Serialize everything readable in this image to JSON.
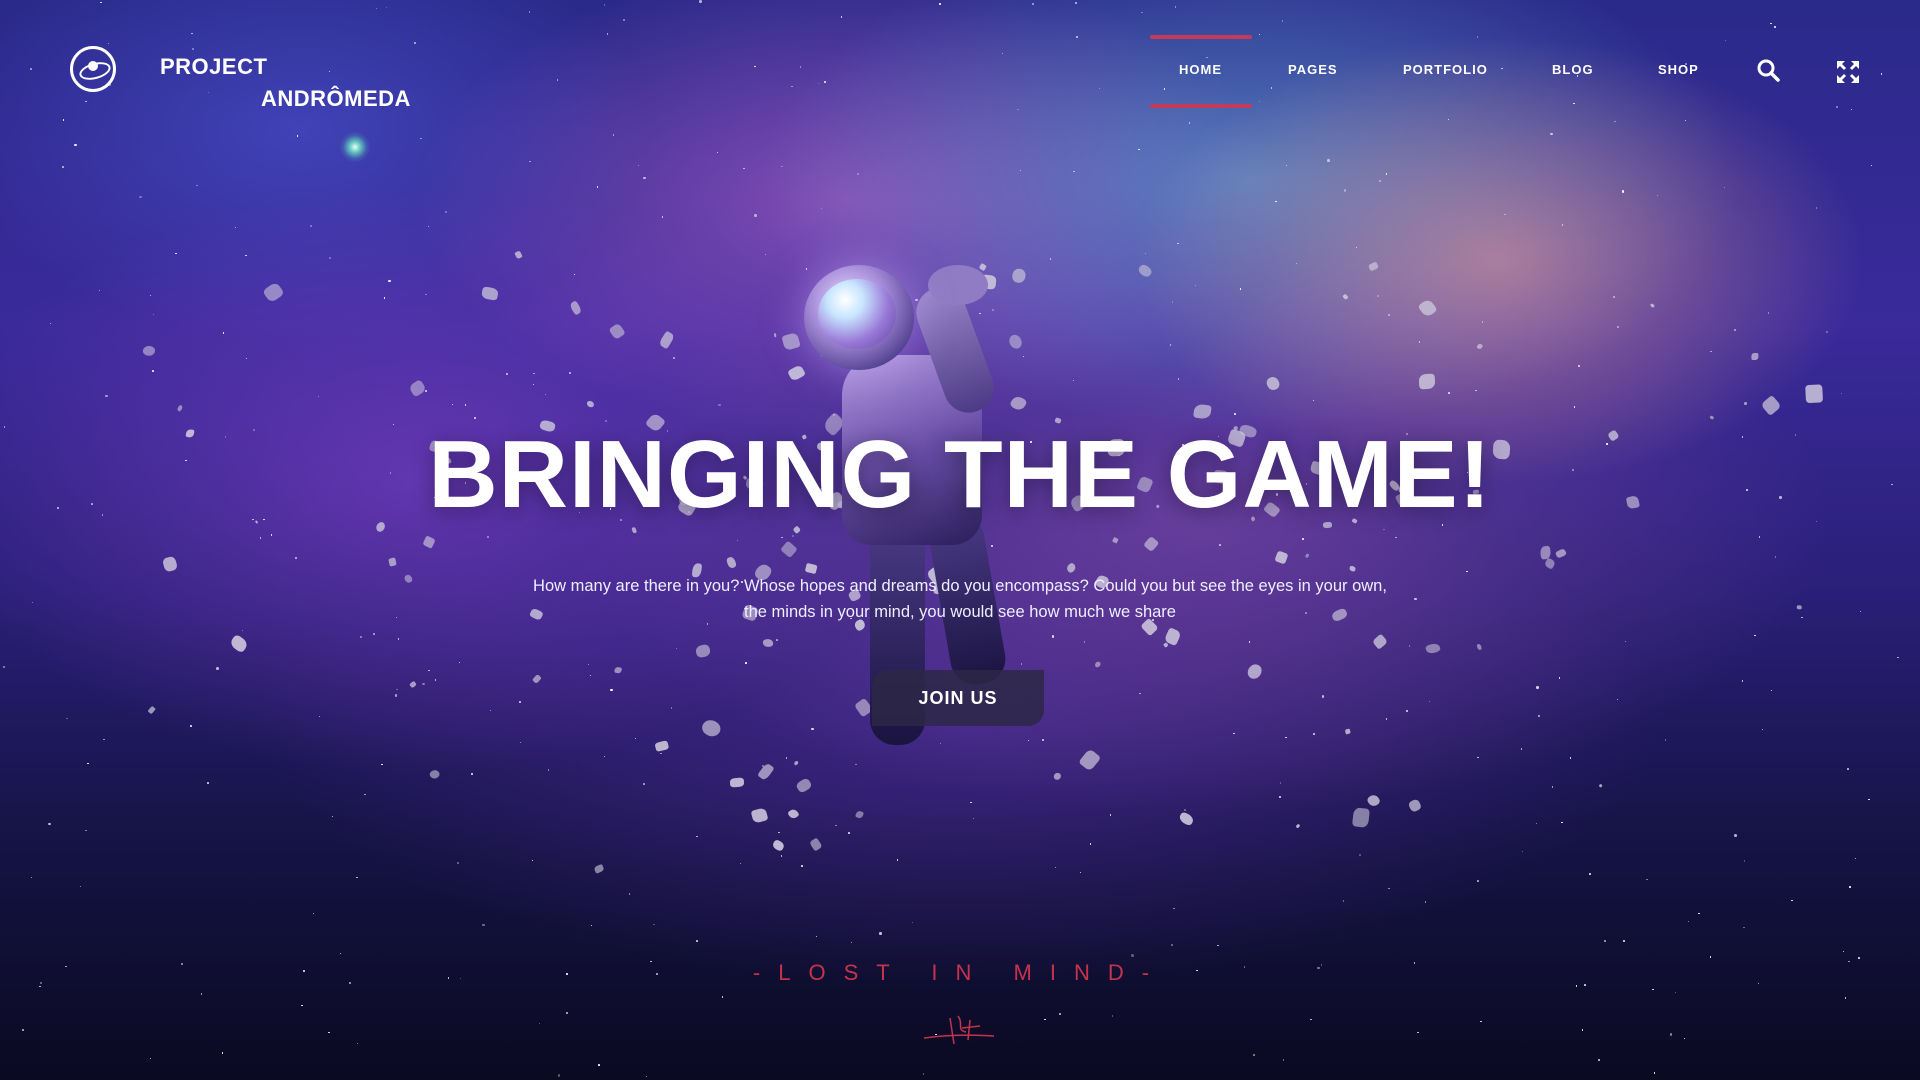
{
  "brand": {
    "line1": "PROJECT",
    "line2": "ANDRÔMEDA",
    "icon": "planet-logo-icon"
  },
  "nav": {
    "items": [
      {
        "label": "HOME",
        "active": true
      },
      {
        "label": "PAGES"
      },
      {
        "label": "PORTFOLIO"
      },
      {
        "label": "BLOG"
      },
      {
        "label": "SHOP"
      }
    ],
    "active_color": "#c43b5a"
  },
  "header_icons": {
    "search": "search-icon",
    "fullscreen": "fullscreen-icon"
  },
  "hero": {
    "title": "BRINGING THE GAME!",
    "description_line1": "How many are there in you? Whose hopes and dreams do you encompass? Could you but see the eyes in your own,",
    "description_line2": "the minds in your mind, you would see how much we share",
    "cta_label": "JOIN US"
  },
  "footer": {
    "tagline": "-LOST IN MIND-",
    "signature_icon": "signature-icon",
    "accent_color": "#c4334c"
  }
}
